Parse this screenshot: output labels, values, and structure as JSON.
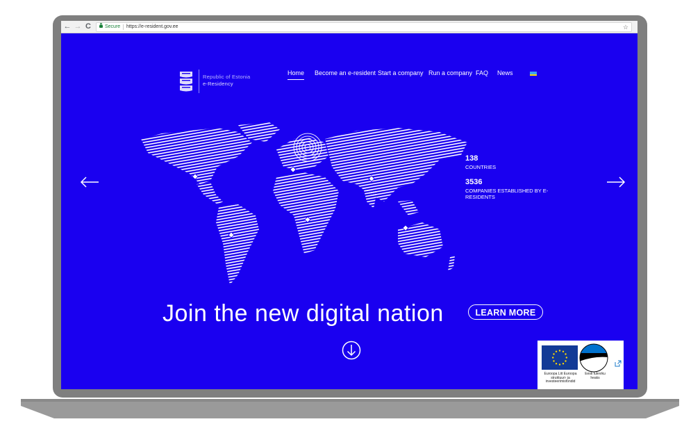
{
  "browser": {
    "back": "←",
    "forward": "→",
    "reload": "C",
    "secure_label": "Secure",
    "url": "https://e-resident.gov.ee",
    "bookmark": "☆"
  },
  "header": {
    "logo_line1": "Republic of Estonia",
    "logo_line2": "e-Residency",
    "nav": [
      {
        "label": "Home",
        "active": true
      },
      {
        "label": "Become an e-resident"
      },
      {
        "label": "Start a company"
      },
      {
        "label": "Run a company"
      },
      {
        "label": "FAQ"
      },
      {
        "label": "News"
      }
    ],
    "language_flag": "ua-flag-icon"
  },
  "stats": [
    {
      "value": "138",
      "label": "COUNTRIES"
    },
    {
      "value": "3536",
      "label": "COMPANIES ESTABLISHED BY E-RESIDENTS"
    }
  ],
  "hero": {
    "headline": "Join the new digital nation",
    "cta": "LEARN MORE"
  },
  "carousel": {
    "prev_icon": "arrow-left-icon",
    "next_icon": "arrow-right-icon",
    "scroll_icon": "arrow-down-circle-icon"
  },
  "funding_badge": {
    "eu_caption": "Euroopa Liit Euroopa struktuuri- ja investeerimisfondid",
    "et_caption": "Eesti tuleviku heaks"
  },
  "colors": {
    "background": "#1a00f0",
    "text": "#ffffff",
    "frame": "#7f7f7f"
  }
}
